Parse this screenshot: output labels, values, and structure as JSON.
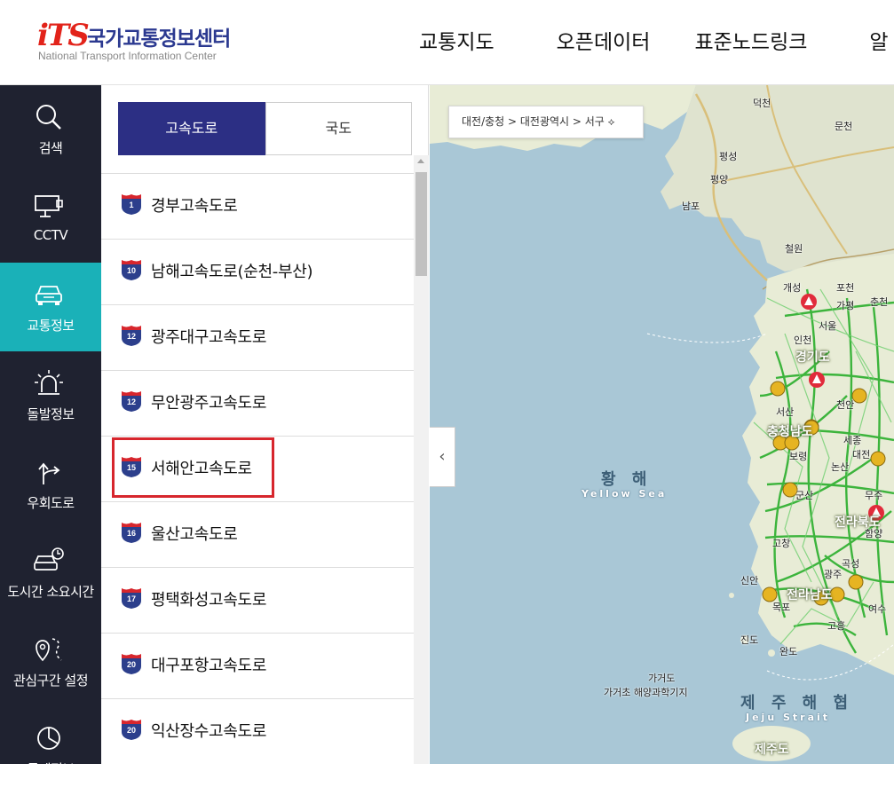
{
  "header": {
    "logo_mark": "iTS",
    "logo_ko": "국가교통정보센터",
    "logo_en": "National Transport Information Center",
    "nav": [
      "교통지도",
      "오픈데이터",
      "표준노드링크",
      "알"
    ]
  },
  "sidebar": {
    "items": [
      {
        "label": "검색",
        "icon": "search-icon"
      },
      {
        "label": "CCTV",
        "icon": "cctv-icon"
      },
      {
        "label": "교통정보",
        "icon": "car-icon",
        "active": true
      },
      {
        "label": "돌발정보",
        "icon": "alert-light-icon"
      },
      {
        "label": "우회도로",
        "icon": "detour-icon"
      },
      {
        "label": "도시간 소요시간",
        "icon": "car-clock-icon"
      },
      {
        "label": "관심구간 설정",
        "icon": "location-route-icon"
      },
      {
        "label": "통계정보",
        "icon": "chart-icon"
      }
    ]
  },
  "panel": {
    "tabs": [
      "고속도로",
      "국도"
    ],
    "active_tab": "고속도로",
    "roads": [
      {
        "num": "1",
        "name": "경부고속도로"
      },
      {
        "num": "10",
        "name": "남해고속도로(순천-부산)"
      },
      {
        "num": "12",
        "name": "광주대구고속도로"
      },
      {
        "num": "12",
        "name": "무안광주고속도로"
      },
      {
        "num": "15",
        "name": "서해안고속도로"
      },
      {
        "num": "16",
        "name": "울산고속도로"
      },
      {
        "num": "17",
        "name": "평택화성고속도로"
      },
      {
        "num": "20",
        "name": "대구포항고속도로"
      },
      {
        "num": "20",
        "name": "익산장수고속도로"
      }
    ]
  },
  "map": {
    "breadcrumb": "대전/충청  >  대전광역시  >  서구 ⟡",
    "collapse_label": "‹",
    "sea_ko": "황 해",
    "sea_en": "Yellow Sea",
    "strait_ko": "제 주 해 협",
    "strait_en": "Jeju Strait",
    "cities": [
      "덕천",
      "문천",
      "평성",
      "평양",
      "남포",
      "철원",
      "개성",
      "포천",
      "가평",
      "서울",
      "인천",
      "춘천",
      "경기도",
      "천안",
      "서산",
      "충청남도",
      "세종",
      "대전",
      "보령",
      "논산",
      "군산",
      "무주",
      "전라북도",
      "함양",
      "고창",
      "광주",
      "곡성",
      "신안",
      "전라남도",
      "목포",
      "여수",
      "고흥",
      "진도",
      "완도",
      "가거도",
      "가거초 해양과학기지",
      "제주도"
    ],
    "colors": {
      "road_green": "#3cb43c",
      "land": "#e8ecd6",
      "sea": "#a9c7d6",
      "nk_land": "#dfe3cf"
    }
  }
}
